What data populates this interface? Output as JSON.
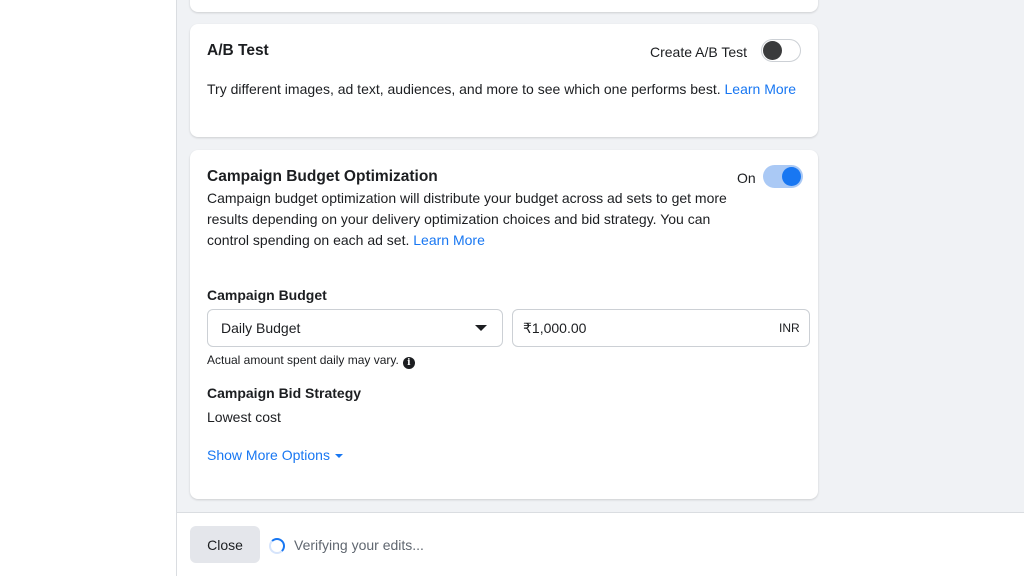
{
  "ab_test": {
    "title": "A/B Test",
    "toggle_label": "Create A/B Test",
    "toggle_on": false,
    "description": "Try different images, ad text, audiences, and more to see which one performs best.",
    "learn_more": "Learn More"
  },
  "cbo": {
    "title": "Campaign Budget Optimization",
    "toggle_label": "On",
    "toggle_on": true,
    "description": "Campaign budget optimization will distribute your budget across ad sets to get more results depending on your delivery optimization choices and bid strategy. You can control spending on each ad set.",
    "learn_more": "Learn More",
    "budget_label": "Campaign Budget",
    "budget_type": "Daily Budget",
    "amount": "₹1,000.00",
    "currency": "INR",
    "hint": "Actual amount spent daily may vary.",
    "info_icon": "i",
    "bid_strategy_label": "Campaign Bid Strategy",
    "bid_strategy_value": "Lowest cost",
    "show_more": "Show More Options"
  },
  "footer": {
    "close_label": "Close",
    "status": "Verifying your edits..."
  },
  "colors": {
    "accent": "#1877f2",
    "background": "#f0f2f5"
  }
}
